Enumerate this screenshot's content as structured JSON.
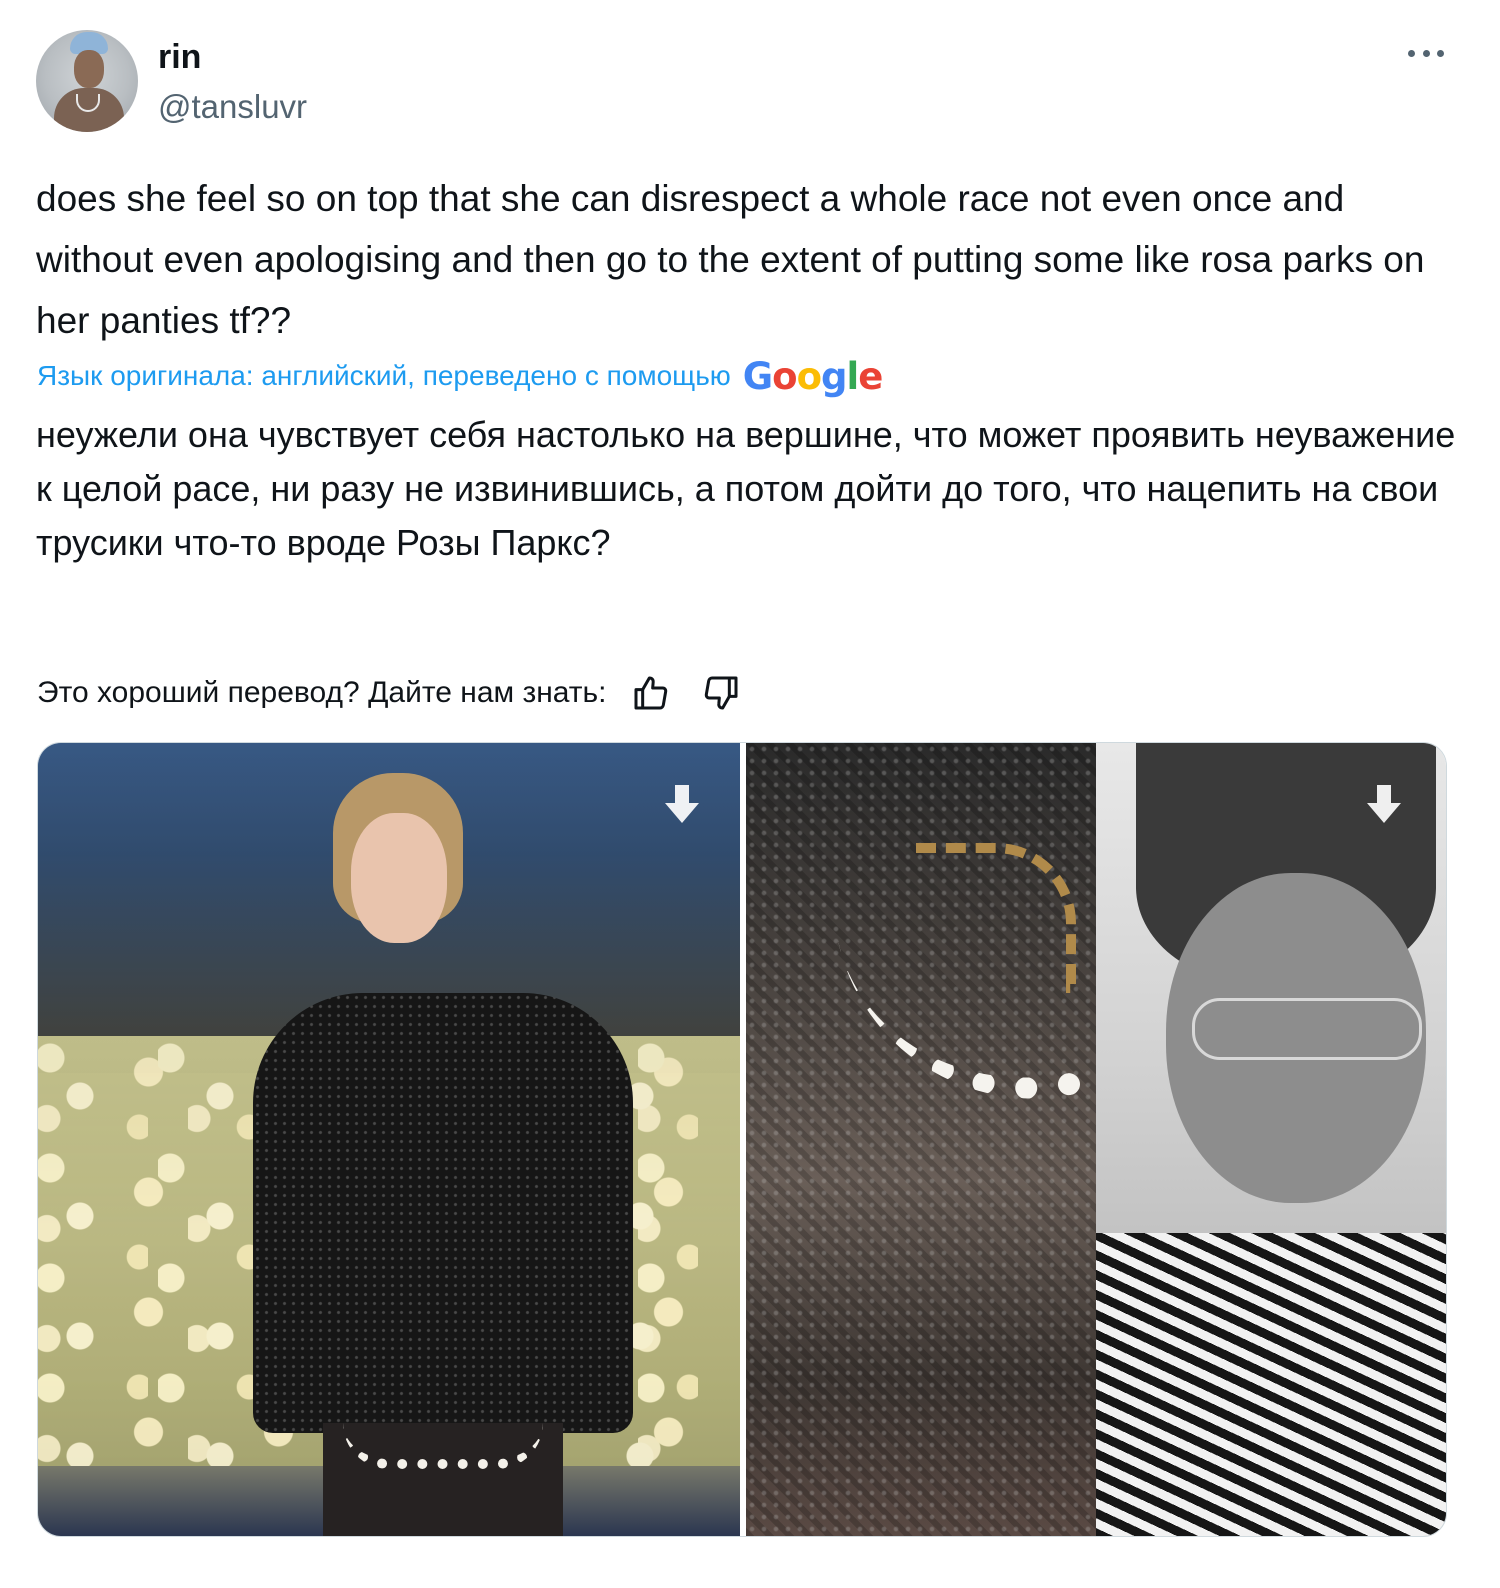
{
  "user": {
    "name": "rin",
    "handle": "@tansluvr"
  },
  "tweet": {
    "text_original": "does she feel so on top that she can disrespect a whole race not even once and without even apologising and then go to the extent of putting some like rosa parks on her panties tf??",
    "translation_notice": "Язык оригинала: английский, переведено с помощью",
    "translation_provider": "Google",
    "text_translated": "неужели она чувствует себя настолько на вершине, что может проявить неуважение к целой расе, ни разу не извинившись, а потом дойти до того, что нацепить на свои трусики что-то вроде Розы Паркс?",
    "feedback_prompt": "Это хороший перевод? Дайте нам знать:"
  },
  "icons": {
    "more": "more-options-icon",
    "thumbs_up": "thumbs-up-icon",
    "thumbs_down": "thumbs-down-icon",
    "download": "download-arrow-icon"
  },
  "colors": {
    "link_blue": "#1d9bf0",
    "secondary_text": "#536471",
    "primary_text": "#0f1419",
    "border": "#cfd9de"
  }
}
